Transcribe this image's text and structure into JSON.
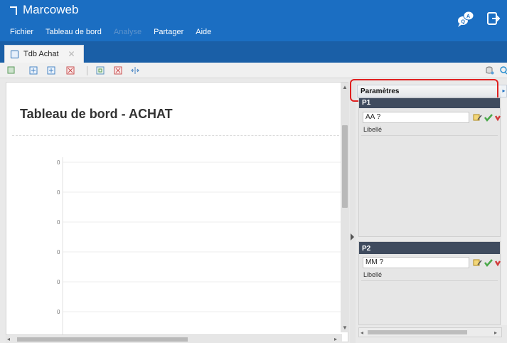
{
  "app": {
    "title": "Marcoweb"
  },
  "menu": {
    "items": [
      {
        "label": "Fichier",
        "enabled": true
      },
      {
        "label": "Tableau de bord",
        "enabled": true
      },
      {
        "label": "Analyse",
        "enabled": false
      },
      {
        "label": "Partager",
        "enabled": true
      },
      {
        "label": "Aide",
        "enabled": true
      }
    ]
  },
  "header_icons": [
    "qa-chat-icon",
    "logout-icon"
  ],
  "tabs": [
    {
      "label": "Tdb Achat",
      "active": true,
      "closable": true
    }
  ],
  "toolbar": {
    "icons": [
      "add-dropdown-icon",
      "add-row-icon",
      "add-col-icon",
      "delete-icon",
      "copy-icon",
      "remove-icon",
      "split-icon",
      "db-refresh-icon",
      "zoom-icon"
    ]
  },
  "dashboard": {
    "title": "Tableau de bord - ACHAT",
    "y_axis_ticks": [
      "0",
      "0",
      "0",
      "0",
      "0",
      "0"
    ]
  },
  "params_panel": {
    "header": "Paramètres",
    "params": [
      {
        "id": "P1",
        "value": "AA ?",
        "label": "Libellé"
      },
      {
        "id": "P2",
        "value": "MM ?",
        "label": "Libellé"
      }
    ]
  },
  "colors": {
    "header_blue": "#1b6ec2",
    "tabbar_blue": "#1a5fa7",
    "param_head_dark": "#3f4b5e",
    "highlight_red": "#e02020"
  }
}
